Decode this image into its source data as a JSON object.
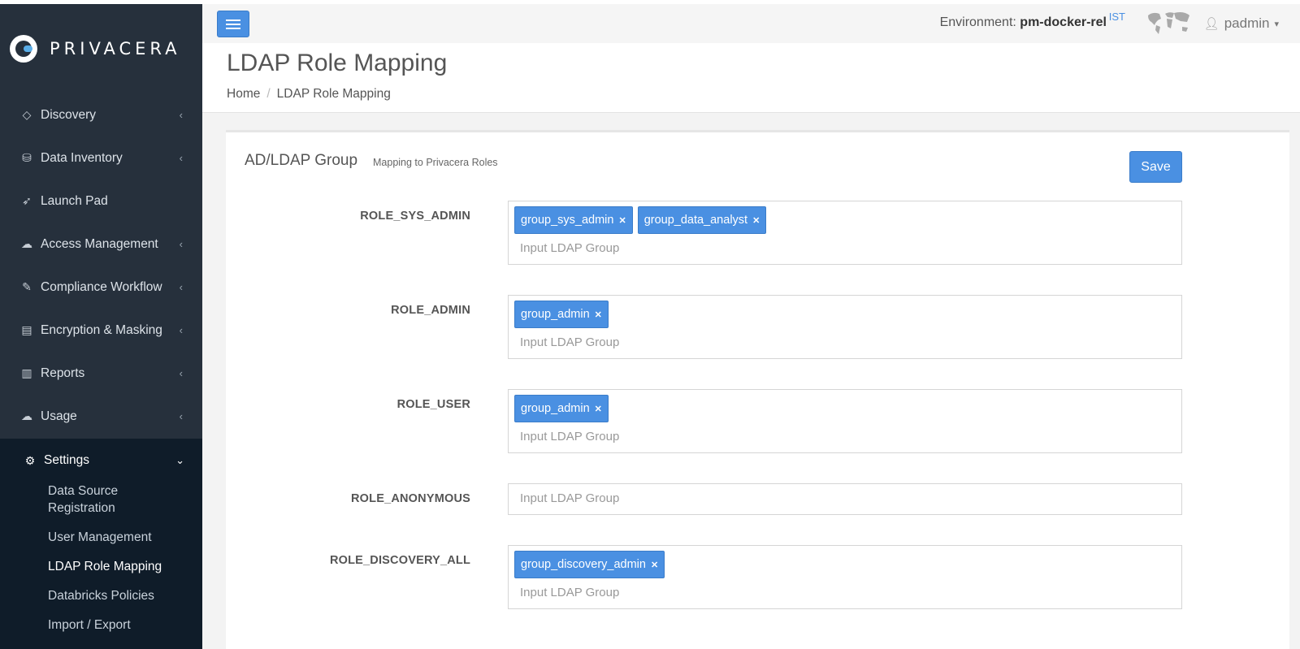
{
  "brand": {
    "name": "PRIVACERA"
  },
  "sidebar": {
    "items": [
      {
        "label": "Discovery",
        "icon": "diamond-icon"
      },
      {
        "label": "Data Inventory",
        "icon": "database-icon"
      },
      {
        "label": "Launch Pad",
        "icon": "rocket-icon"
      },
      {
        "label": "Access Management",
        "icon": "cloud-icon"
      },
      {
        "label": "Compliance Workflow",
        "icon": "file-edit-icon"
      },
      {
        "label": "Encryption & Masking",
        "icon": "file-lock-icon"
      },
      {
        "label": "Reports",
        "icon": "report-icon"
      },
      {
        "label": "Usage",
        "icon": "cloud-icon"
      }
    ],
    "settings": {
      "label": "Settings",
      "icon": "gear-icon",
      "children": [
        {
          "label": "Data Source Registration"
        },
        {
          "label": "User Management"
        },
        {
          "label": "LDAP Role Mapping",
          "active": true
        },
        {
          "label": "Databricks Policies"
        },
        {
          "label": "Import / Export"
        }
      ]
    }
  },
  "topbar": {
    "env_label": "Environment:",
    "env_value": "pm-docker-rel",
    "timezone": "IST",
    "user": "padmin"
  },
  "header": {
    "title": "LDAP Role Mapping",
    "breadcrumb": [
      "Home",
      "LDAP Role Mapping"
    ]
  },
  "panel": {
    "title": "AD/LDAP Group",
    "subtitle": "Mapping to Privacera Roles",
    "save_label": "Save",
    "placeholder": "Input LDAP Group",
    "roles": [
      {
        "name": "ROLE_SYS_ADMIN",
        "groups": [
          "group_sys_admin",
          "group_data_analyst"
        ]
      },
      {
        "name": "ROLE_ADMIN",
        "groups": [
          "group_admin"
        ]
      },
      {
        "name": "ROLE_USER",
        "groups": [
          "group_admin"
        ]
      },
      {
        "name": "ROLE_ANONYMOUS",
        "groups": []
      },
      {
        "name": "ROLE_DISCOVERY_ALL",
        "groups": [
          "group_discovery_admin"
        ]
      }
    ]
  },
  "colors": {
    "accent": "#4a90e2",
    "sidebar": "#26303c",
    "sidebar_active": "#0f1c29"
  }
}
